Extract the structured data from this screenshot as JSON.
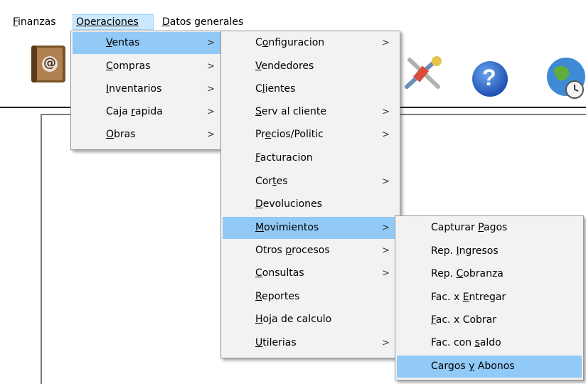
{
  "menubar": {
    "items": [
      {
        "label": "Finanzas"
      },
      {
        "label": "Operaciones"
      },
      {
        "label": "Datos generales"
      }
    ]
  },
  "operaciones_menu": {
    "items": [
      {
        "label": "Ventas",
        "submenu": true
      },
      {
        "label": "Compras",
        "submenu": true
      },
      {
        "label": "Inventarios",
        "submenu": true
      },
      {
        "label": "Caja rapida",
        "submenu": true
      },
      {
        "label": "Obras",
        "submenu": true
      }
    ]
  },
  "ventas_menu": {
    "items": [
      {
        "label": "Configuracion",
        "submenu": true
      },
      {
        "label": "Vendedores",
        "submenu": false
      },
      {
        "label": "Clientes",
        "submenu": false
      },
      {
        "label": "Serv al cliente",
        "submenu": true
      },
      {
        "label": "Precios/Politic",
        "submenu": true
      },
      {
        "label": "Facturacion",
        "submenu": false
      },
      {
        "label": "Cortes",
        "submenu": true
      },
      {
        "label": "Devoluciones",
        "submenu": false
      },
      {
        "label": "Movimientos",
        "submenu": true
      },
      {
        "label": "Otros procesos",
        "submenu": true
      },
      {
        "label": "Consultas",
        "submenu": true
      },
      {
        "label": "Reportes",
        "submenu": false
      },
      {
        "label": "Hoja de calculo",
        "submenu": false
      },
      {
        "label": "Utilerias",
        "submenu": true
      }
    ]
  },
  "movimientos_menu": {
    "items": [
      {
        "label": "Capturar Pagos"
      },
      {
        "label": "Rep. Ingresos"
      },
      {
        "label": "Rep. Cobranza"
      },
      {
        "label": "Fac. x Entregar"
      },
      {
        "label": "Fac. x Cobrar"
      },
      {
        "label": "Fac. con saldo"
      },
      {
        "label": "Cargos y Abonos"
      }
    ]
  },
  "glyphs": {
    "submenu_arrow": ">",
    "email_symbol": "@",
    "help_symbol": "?"
  },
  "colors": {
    "menu_bg": "#f2f2f2",
    "highlight": "#91c9f7",
    "active_top": "#cce8ff",
    "help_blue": "#2a64c8"
  }
}
